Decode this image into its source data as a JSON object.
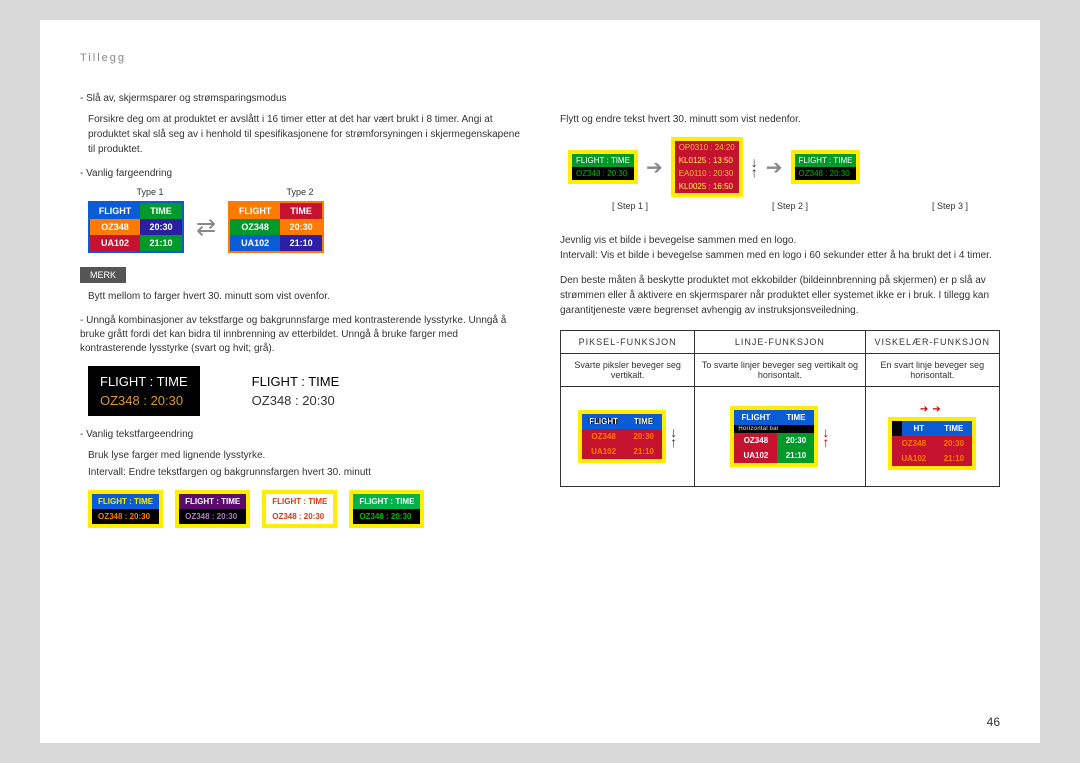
{
  "header": {
    "title": "Tillegg"
  },
  "left": {
    "b1": "Slå av, skjermsparer og strømsparingsmodus",
    "p1": "Forsikre deg om at produktet er avslått i 16 timer etter at det har vært brukt i 8 timer. Angi at produktet skal slå seg av i henhold til spesifikasjonene for strømforsyningen i skjermegenskapene til produktet.",
    "b2": "Vanlig fargeendring",
    "types": {
      "t1": "Type 1",
      "t2": "Type 2"
    },
    "ftable": {
      "h1": "FLIGHT",
      "h2": "TIME",
      "r1a": "OZ348",
      "r1b": "20:30",
      "r2a": "UA102",
      "r2b": "21:10"
    },
    "merk": "MERK",
    "p2": "Bytt mellom to farger hvert 30. minutt som vist ovenfor.",
    "b3": "Unngå kombinasjoner av tekstfarge og bakgrunnsfarge med kontrasterende lysstyrke. Unngå å bruke grått fordi det kan bidra til innbrenning av etterbildet. Unngå å bruke farger med kontrasterende lysstyrke (svart og hvit; grå).",
    "contrast": {
      "h": "FLIGHT   :   TIME",
      "r": "OZ348    :    20:30"
    },
    "b4": "Vanlig tekstfargeendring",
    "p3": "Bruk lyse farger med lignende lysstyrke.",
    "p4": "Intervall: Endre tekstfargen og bakgrunnsfargen hvert 30. minutt",
    "tc_header": "FLIGHT   :   TIME",
    "tc_row": "OZ348   :   20:30"
  },
  "right": {
    "p1": "Flytt og endre tekst hvert 30. minutt som vist nedenfor.",
    "steps": {
      "s1l1": "FLIGHT   :   TIME",
      "s1l2": "OZ348    :   20:30",
      "s2l1": "OP0310  :  24:20",
      "s2l2": "KL0125  :  13:50",
      "s2l3": "EA0110  :  20:30",
      "s2l4": "KL0025  :  16:50",
      "label1": "[ Step 1 ]",
      "label2": "[ Step 2 ]",
      "label3": "[ Step 3 ]"
    },
    "p2": "Jevnlig vis et bilde i bevegelse sammen med en logo.",
    "p3": "Intervall: Vis et bilde i bevegelse sammen med en logo i 60 sekunder etter å ha brukt det i 4 timer.",
    "p4": "Den beste måten å beskytte produktet mot ekkobilder (bildeinnbrenning på skjermen) er p slå av strømmen eller å aktivere en skjermsparer når produktet eller systemet ikke er i bruk. I tillegg kan garantitjeneste være begrenset avhengig av instruksjonsveiledning.",
    "table": {
      "th1": "PIKSEL-FUNKSJON",
      "th2": "LINJE-FUNKSJON",
      "th3": "VISKELÆR-FUNKSJON",
      "td1": "Svarte piksler beveger seg vertikalt.",
      "td2": "To svarte linjer beveger seg vertikalt og horisontalt.",
      "td3": "En svart linje beveger seg horisontalt."
    },
    "board": {
      "h1": "FLIGHT",
      "h2": "TIME",
      "r1a": "OZ348",
      "r1b": "20:30",
      "r2a": "UA102",
      "r2b": "21:10",
      "hbar": "Horizontal bar"
    }
  },
  "pagenum": "46"
}
